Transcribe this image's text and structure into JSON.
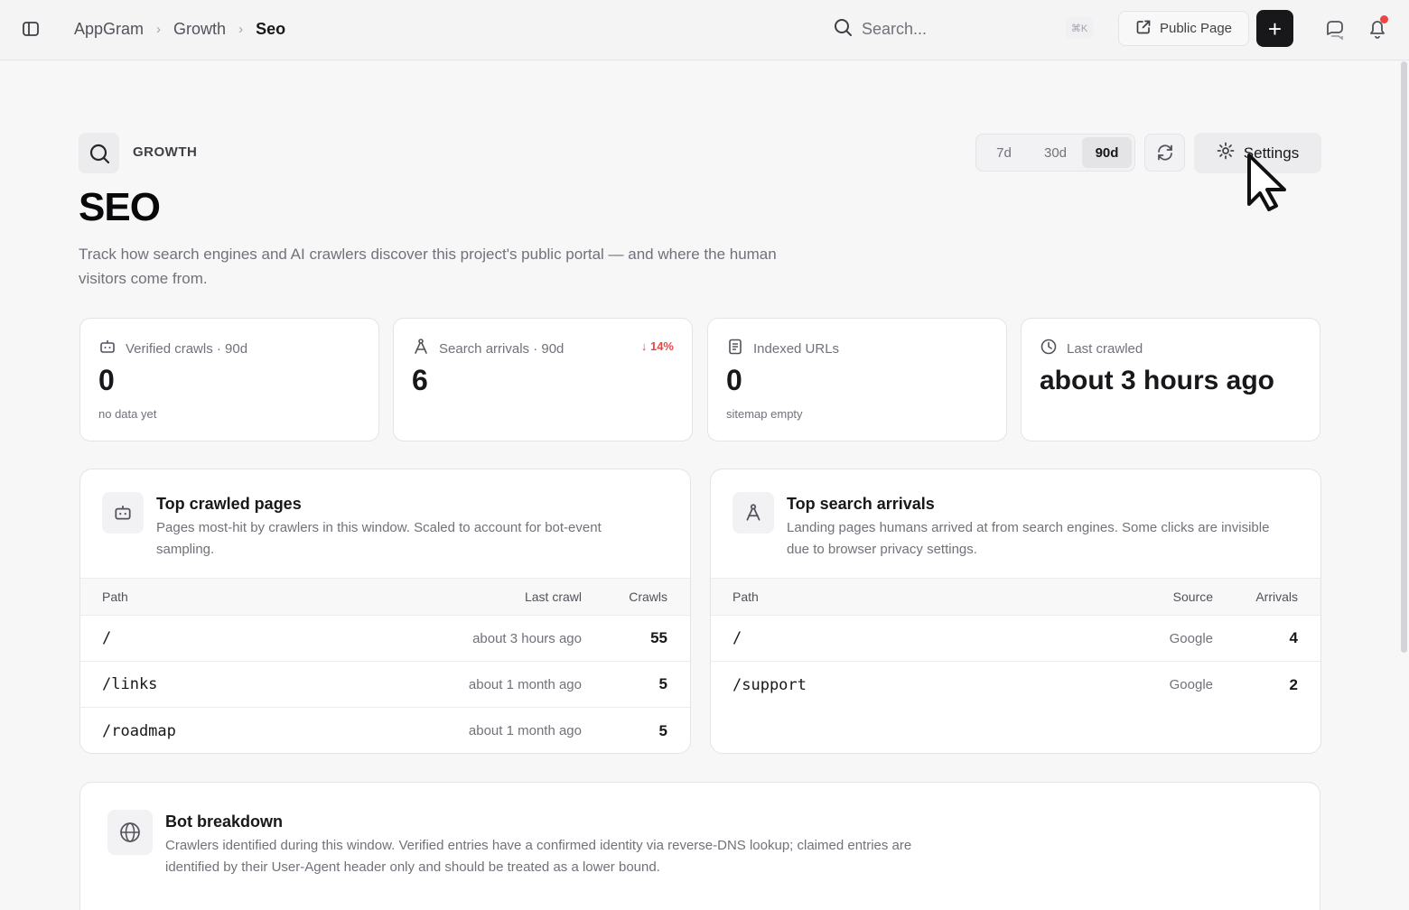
{
  "header": {
    "breadcrumb": [
      "AppGram",
      "Growth",
      "Seo"
    ],
    "search_placeholder": "Search...",
    "search_shortcut": "⌘K",
    "public_page_label": "Public Page",
    "add_label": "+",
    "notification_dot_color": "#ef4444"
  },
  "page": {
    "section_label": "GROWTH",
    "title": "SEO",
    "description": "Track how search engines and AI crawlers discover this project's public portal — and where the human visitors come from."
  },
  "controls": {
    "ranges": [
      "7d",
      "30d",
      "90d"
    ],
    "selected_range": "90d",
    "settings_label": "Settings"
  },
  "stats": [
    {
      "icon": "bot-icon",
      "label": "Verified crawls · 90d",
      "value": "0",
      "sub": "no data yet",
      "delta": ""
    },
    {
      "icon": "compass-icon",
      "label": "Search arrivals · 90d",
      "value": "6",
      "sub": "",
      "delta": "↓ 14%"
    },
    {
      "icon": "document-icon",
      "label": "Indexed URLs",
      "value": "0",
      "sub": "sitemap empty",
      "delta": ""
    },
    {
      "icon": "clock-icon",
      "label": "Last crawled",
      "value": "about 3 hours ago",
      "sub": "",
      "delta": ""
    }
  ],
  "crawled": {
    "title": "Top crawled pages",
    "description": "Pages most-hit by crawlers in this window. Scaled to account for bot-event sampling.",
    "columns": [
      "Path",
      "Last crawl",
      "Crawls"
    ],
    "rows": [
      {
        "path": "/",
        "last": "about 3 hours ago",
        "count": "55"
      },
      {
        "path": "/links",
        "last": "about 1 month ago",
        "count": "5"
      },
      {
        "path": "/roadmap",
        "last": "about 1 month ago",
        "count": "5"
      }
    ]
  },
  "arrivals": {
    "title": "Top search arrivals",
    "description": "Landing pages humans arrived at from search engines. Some clicks are invisible due to browser privacy settings.",
    "columns": [
      "Path",
      "Source",
      "Arrivals"
    ],
    "rows": [
      {
        "path": "/",
        "source": "Google",
        "count": "4"
      },
      {
        "path": "/support",
        "source": "Google",
        "count": "2"
      }
    ]
  },
  "bots": {
    "title": "Bot breakdown",
    "description": "Crawlers identified during this window. Verified entries have a confirmed identity via reverse-DNS lookup; claimed entries are identified by their User-Agent header only and should be treated as a lower bound."
  }
}
